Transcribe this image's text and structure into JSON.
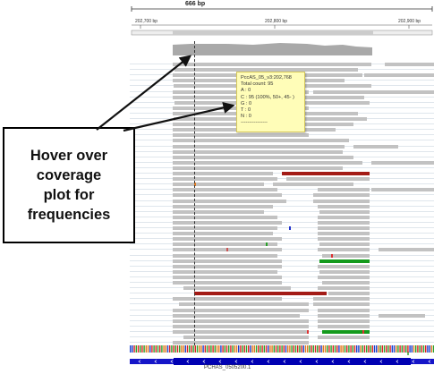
{
  "ruler": {
    "span_label": "666 bp",
    "ticks": [
      "202,700 bp",
      "202,800 bp",
      "202,900 bp"
    ]
  },
  "tooltip": {
    "lines": [
      "PccAS_05_v3:202,768",
      "Total count: 95",
      "A : 0",
      "C : 95 (100%, 50+, 45- )",
      "G : 0",
      "T : 0",
      "N : 0",
      "----------------"
    ]
  },
  "callout": {
    "lines": [
      "Hover over",
      "coverage",
      "plot for",
      "frequencies"
    ]
  },
  "gene": {
    "name": "PCHAS_0505200.1"
  },
  "colors": {
    "read": "#c2c2c2",
    "reverse_read_highlight": "#a31b16",
    "forward_read_highlight": "#149a1c",
    "coverage": "#a9a9a9",
    "tooltip_bg": "#fffdb8",
    "gene": "#0000b2"
  }
}
